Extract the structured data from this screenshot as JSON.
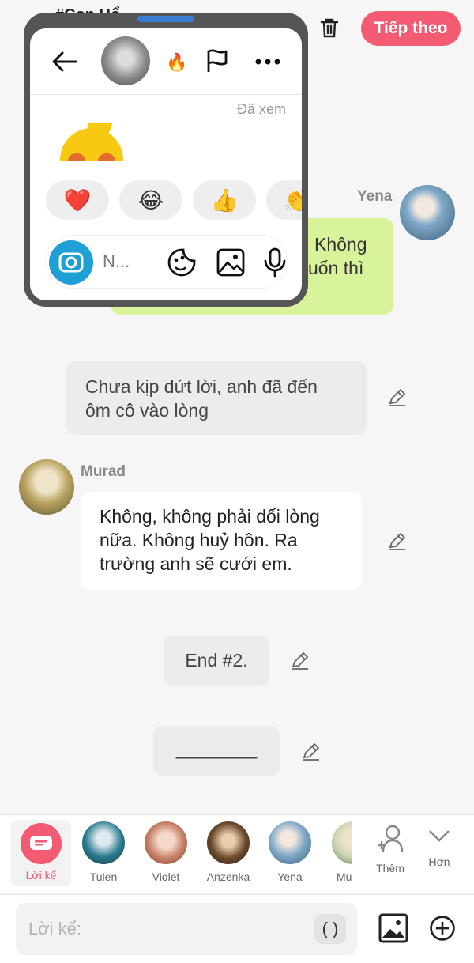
{
  "header": {
    "title": "#Con Hổ",
    "next_label": "Tiếp theo"
  },
  "popup": {
    "seen_label": "Đã xem",
    "reactions": [
      "❤️",
      "😂",
      "👍",
      "👏"
    ],
    "compose_placeholder": "N..."
  },
  "messages": [
    {
      "sender": "Yena",
      "text_line1": "Không",
      "text_line2": "uốn thì"
    },
    {
      "text": "Chưa kịp dứt lời, anh đã đến ôm cô vào lòng"
    },
    {
      "sender": "Murad",
      "text": "Không, không phải dối lòng nữa. Không huỷ hôn. Ra trường anh sẽ cưới em."
    },
    {
      "text": "End #2."
    },
    {
      "text": "________"
    }
  ],
  "characters": [
    {
      "name": "Lời kể",
      "color": "#f25b72",
      "active": true
    },
    {
      "name": "Tulen",
      "color": "#2b7a8f"
    },
    {
      "name": "Violet",
      "color": "#c8826a"
    },
    {
      "name": "Anzenka",
      "color": "#6b4a2c"
    },
    {
      "name": "Yena",
      "color": "#7fa9c8"
    },
    {
      "name": "Mu",
      "color": "#c9d6b8"
    }
  ],
  "char_actions": {
    "add_label": "Thêm",
    "more_label": "Hơn"
  },
  "composer": {
    "placeholder": "Lời kể:",
    "paren_label": "( )"
  }
}
